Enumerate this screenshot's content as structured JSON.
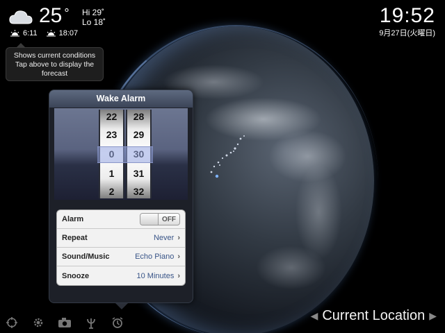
{
  "weather": {
    "icon": "cloud-icon",
    "temperature": "25",
    "degree": "°",
    "hi": "Hi 29˚",
    "lo": "Lo 18˚",
    "sunrise": "6:11",
    "sunset": "18:07"
  },
  "tooltip": {
    "line1": "Shows current conditions",
    "line2": "Tap above to display the",
    "line3": "forecast"
  },
  "clock": {
    "time": "19:52",
    "date": "9月27日(火曜日)"
  },
  "wake_alarm": {
    "title": "Wake Alarm",
    "hours": [
      "22",
      "23",
      "0",
      "1",
      "2"
    ],
    "minutes": [
      "28",
      "29",
      "30",
      "31",
      "32"
    ],
    "selected_hour": "0",
    "selected_minute": "30",
    "rows": {
      "alarm_label": "Alarm",
      "alarm_toggle": "OFF",
      "repeat_label": "Repeat",
      "repeat_value": "Never",
      "sound_label": "Sound/Music",
      "sound_value": "Echo Piano",
      "snooze_label": "Snooze",
      "snooze_value": "10 Minutes"
    }
  },
  "toolbar": {
    "icons": [
      "crosshair-icon",
      "gear-icon",
      "camera-icon",
      "antenna-icon",
      "alarm-clock-icon"
    ]
  },
  "location": {
    "label": "Current Location"
  },
  "colors": {
    "value_text": "#385487",
    "header_top": "#5e6a80",
    "picker_select": "#96a5e1"
  }
}
